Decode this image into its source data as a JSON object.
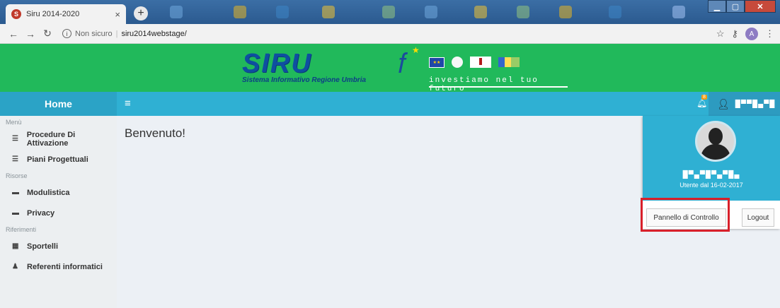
{
  "browser": {
    "tab_title": "Siru 2014-2020",
    "tab_favicon": "S",
    "tab_close": "×",
    "new_tab": "+",
    "insecure_label": "Non sicuro",
    "url": "siru2014webstage/",
    "account_initial": "A",
    "icons": [
      "back-icon",
      "forward-icon",
      "reload-icon",
      "info-icon",
      "star-icon",
      "key-icon",
      "menu-icon"
    ]
  },
  "banner": {
    "logo_title": "SIRU",
    "logo_subtitle": "Sistema Informativo Regione Umbria",
    "slogan": "investiamo nel tuo futuro",
    "bg_color": "#21b95b"
  },
  "header": {
    "home_label": "Home",
    "notification_count": "8",
    "user_name": "█▀▀█▄▀█",
    "color": "#2fb0d3"
  },
  "sidebar": {
    "sections": [
      {
        "title": "Menù",
        "items": [
          {
            "label": "Procedure Di Attivazione",
            "icon": "list-icon"
          },
          {
            "label": "Piani Progettuali",
            "icon": "list-icon"
          }
        ]
      },
      {
        "title": "Risorse",
        "items": [
          {
            "label": "Modulistica",
            "icon": "folder-icon"
          },
          {
            "label": "Privacy",
            "icon": "folder-icon"
          }
        ]
      },
      {
        "title": "Riferimenti",
        "items": [
          {
            "label": "Sportelli",
            "icon": "building-icon"
          },
          {
            "label": "Referenti informatici",
            "icon": "user-icon"
          }
        ]
      }
    ]
  },
  "main": {
    "welcome": "Benvenuto!"
  },
  "user_dropdown": {
    "name": "█▀▄▀█▀▄▀█▄",
    "since": "Utente dal 16-02-2017",
    "control_panel_label": "Pannello di Controllo",
    "logout_label": "Logout"
  }
}
